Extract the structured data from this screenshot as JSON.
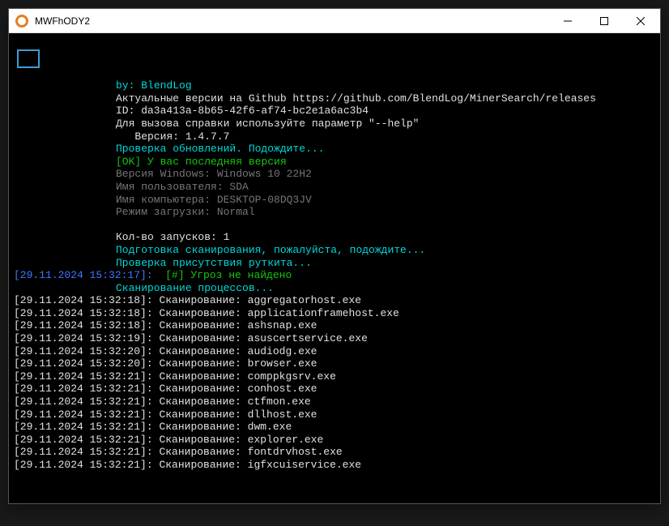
{
  "window": {
    "title": "MWFhODY2"
  },
  "app": {
    "by_label": "by: ",
    "author": "BlendLog",
    "releases_line": "Актуальные версии на Github https://github.com/BlendLog/MinerSearch/releases",
    "id_line": "ID: da3a413a-8b65-42f6-af74-bc2e1a6ac3b4",
    "help_line": "Для вызова справки используйте параметр \"--help\"",
    "version_label": "   Версия: ",
    "version": "1.4.7.7",
    "update_check": "Проверка обновлений. Подождите...",
    "ok_prefix": "[OK] ",
    "ok_text": "У вас последняя версия",
    "win_version": "Версия Windows: Windows 10 22H2",
    "username": "Имя пользователя: SDA",
    "hostname": "Имя компьютера: DESKTOP-08DQ3JV",
    "bootmode": "Режим загрузки: Normal",
    "runs": "Кол-во запусков: 1",
    "prepare": "Подготовка сканирования, пожалуйста, подождите...",
    "rootkit": "Проверка присутствия руткита...",
    "ts_main": "[29.11.2024 15:32:17]:  ",
    "threats": "[#] Угроз не найдено",
    "scan_procs": "Сканирование процессов..."
  },
  "scan": [
    {
      "ts": "[29.11.2024 15:32:18]: ",
      "label": "Сканирование: ",
      "proc": "aggregatorhost.exe"
    },
    {
      "ts": "[29.11.2024 15:32:18]: ",
      "label": "Сканирование: ",
      "proc": "applicationframehost.exe"
    },
    {
      "ts": "[29.11.2024 15:32:18]: ",
      "label": "Сканирование: ",
      "proc": "ashsnap.exe"
    },
    {
      "ts": "[29.11.2024 15:32:19]: ",
      "label": "Сканирование: ",
      "proc": "asuscertservice.exe"
    },
    {
      "ts": "[29.11.2024 15:32:20]: ",
      "label": "Сканирование: ",
      "proc": "audiodg.exe"
    },
    {
      "ts": "[29.11.2024 15:32:20]: ",
      "label": "Сканирование: ",
      "proc": "browser.exe"
    },
    {
      "ts": "[29.11.2024 15:32:21]: ",
      "label": "Сканирование: ",
      "proc": "comppkgsrv.exe"
    },
    {
      "ts": "[29.11.2024 15:32:21]: ",
      "label": "Сканирование: ",
      "proc": "conhost.exe"
    },
    {
      "ts": "[29.11.2024 15:32:21]: ",
      "label": "Сканирование: ",
      "proc": "ctfmon.exe"
    },
    {
      "ts": "[29.11.2024 15:32:21]: ",
      "label": "Сканирование: ",
      "proc": "dllhost.exe"
    },
    {
      "ts": "[29.11.2024 15:32:21]: ",
      "label": "Сканирование: ",
      "proc": "dwm.exe"
    },
    {
      "ts": "[29.11.2024 15:32:21]: ",
      "label": "Сканирование: ",
      "proc": "explorer.exe"
    },
    {
      "ts": "[29.11.2024 15:32:21]: ",
      "label": "Сканирование: ",
      "proc": "fontdrvhost.exe"
    },
    {
      "ts": "[29.11.2024 15:32:21]: ",
      "label": "Сканирование: ",
      "proc": "igfxcuiservice.exe"
    }
  ]
}
